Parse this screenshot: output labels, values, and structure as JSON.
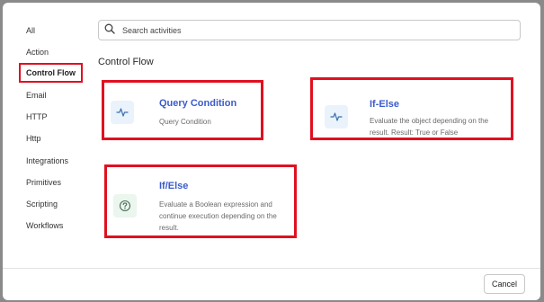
{
  "sidebar": {
    "items": [
      {
        "label": "All"
      },
      {
        "label": "Action"
      },
      {
        "label": "Control Flow"
      },
      {
        "label": "Email"
      },
      {
        "label": "HTTP"
      },
      {
        "label": "Http"
      },
      {
        "label": "Integrations"
      },
      {
        "label": "Primitives"
      },
      {
        "label": "Scripting"
      },
      {
        "label": "Workflows"
      }
    ],
    "active": "Control Flow"
  },
  "search": {
    "placeholder": "Search activities",
    "value": ""
  },
  "section": {
    "title": "Control Flow"
  },
  "cards": [
    {
      "title": "Query Condition",
      "description": "Query Condition",
      "icon": "pulse-icon"
    },
    {
      "title": "If-Else",
      "description": "Evaluate the object depending on the result. Result: True or False",
      "icon": "pulse-icon"
    },
    {
      "title": "If/Else",
      "description": "Evaluate a Boolean expression and continue execution depending on the result.",
      "icon": "question-circle-icon"
    }
  ],
  "footer": {
    "cancel_label": "Cancel"
  },
  "colors": {
    "highlight": "#e01020",
    "title": "#3b5bcc"
  }
}
